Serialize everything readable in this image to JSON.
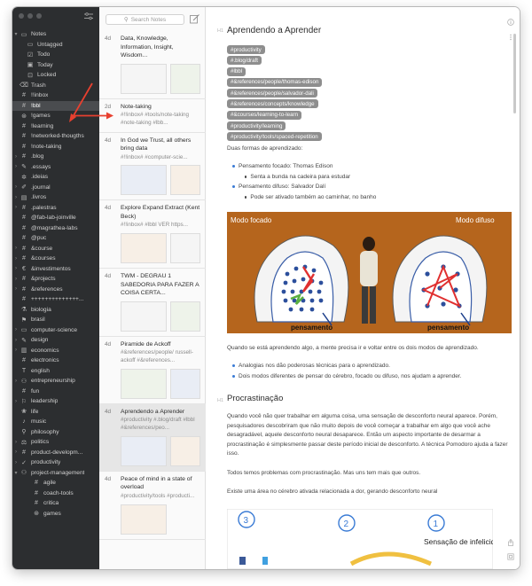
{
  "sidebar": {
    "items": [
      {
        "label": "Notes",
        "icon": "notes-icon",
        "glyph": "▭",
        "chev": "▾",
        "level": 0
      },
      {
        "label": "Untagged",
        "icon": "untagged-icon",
        "glyph": "▭",
        "chev": "",
        "level": 1
      },
      {
        "label": "Todo",
        "icon": "todo-icon",
        "glyph": "☑",
        "chev": "",
        "level": 1
      },
      {
        "label": "Today",
        "icon": "today-icon",
        "glyph": "▣",
        "chev": "",
        "level": 1
      },
      {
        "label": "Locked",
        "icon": "lock-icon",
        "glyph": "⊡",
        "chev": "",
        "level": 1
      },
      {
        "label": "Trash",
        "icon": "trash-icon",
        "glyph": "⌫",
        "chev": "",
        "level": 0
      },
      {
        "label": "!!inbox",
        "icon": "tag-icon",
        "glyph": "#",
        "chev": "",
        "level": 0
      },
      {
        "label": "!bbl",
        "icon": "tag-icon",
        "glyph": "#",
        "chev": "",
        "level": 0,
        "selected": true
      },
      {
        "label": "!games",
        "icon": "gamepad-icon",
        "glyph": "⊛",
        "chev": "",
        "level": 0
      },
      {
        "label": "!learning",
        "icon": "tag-icon",
        "glyph": "#",
        "chev": "",
        "level": 0
      },
      {
        "label": "!networked-thougths",
        "icon": "tag-icon",
        "glyph": "#",
        "chev": "",
        "level": 0
      },
      {
        "label": "!note-taking",
        "icon": "tag-icon",
        "glyph": "#",
        "chev": "",
        "level": 0
      },
      {
        "label": ".blog",
        "icon": "tag-icon",
        "glyph": "#",
        "chev": "›",
        "level": 0
      },
      {
        "label": ".essays",
        "icon": "essay-icon",
        "glyph": "✎",
        "chev": "›",
        "level": 0
      },
      {
        "label": ".ideias",
        "icon": "lightbulb-icon",
        "glyph": "✲",
        "chev": "",
        "level": 0
      },
      {
        "label": ".journal",
        "icon": "journal-icon",
        "glyph": "✐",
        "chev": "›",
        "level": 0
      },
      {
        "label": ".livros",
        "icon": "book-icon",
        "glyph": "▤",
        "chev": "›",
        "level": 0
      },
      {
        "label": ".palestras",
        "icon": "tag-icon",
        "glyph": "#",
        "chev": "›",
        "level": 0
      },
      {
        "label": "@fab-lab-joinville",
        "icon": "tag-icon",
        "glyph": "#",
        "chev": "",
        "level": 0
      },
      {
        "label": "@magrathea-labs",
        "icon": "tag-icon",
        "glyph": "#",
        "chev": "",
        "level": 0
      },
      {
        "label": "@puc",
        "icon": "tag-icon",
        "glyph": "#",
        "chev": "",
        "level": 0
      },
      {
        "label": "&course",
        "icon": "tag-icon",
        "glyph": "#",
        "chev": "›",
        "level": 0
      },
      {
        "label": "&courses",
        "icon": "tag-icon",
        "glyph": "#",
        "chev": "›",
        "level": 0
      },
      {
        "label": "&investimentos",
        "icon": "euro-icon",
        "glyph": "€",
        "chev": "›",
        "level": 0
      },
      {
        "label": "&projects",
        "icon": "tag-icon",
        "glyph": "#",
        "chev": "›",
        "level": 0
      },
      {
        "label": "&references",
        "icon": "tag-icon",
        "glyph": "#",
        "chev": "›",
        "level": 0
      },
      {
        "label": "++++++++++++++...",
        "icon": "tag-icon",
        "glyph": "#",
        "chev": "",
        "level": 0
      },
      {
        "label": "biologia",
        "icon": "flask-icon",
        "glyph": "⚗",
        "chev": "",
        "level": 0
      },
      {
        "label": "brasil",
        "icon": "flag-icon",
        "glyph": "⚑",
        "chev": "",
        "level": 0
      },
      {
        "label": "computer-science",
        "icon": "computer-icon",
        "glyph": "▭",
        "chev": "›",
        "level": 0
      },
      {
        "label": "design",
        "icon": "design-icon",
        "glyph": "✎",
        "chev": "›",
        "level": 0
      },
      {
        "label": "economics",
        "icon": "chart-icon",
        "glyph": "▥",
        "chev": "›",
        "level": 0
      },
      {
        "label": "electronics",
        "icon": "tag-icon",
        "glyph": "#",
        "chev": "",
        "level": 0
      },
      {
        "label": "english",
        "icon": "text-icon",
        "glyph": "T",
        "chev": "",
        "level": 0
      },
      {
        "label": "entrepreneurship",
        "icon": "people-icon",
        "glyph": "⚇",
        "chev": "›",
        "level": 0
      },
      {
        "label": "fun",
        "icon": "tag-icon",
        "glyph": "#",
        "chev": "",
        "level": 0
      },
      {
        "label": "leadership",
        "icon": "leadership-icon",
        "glyph": "⚐",
        "chev": "›",
        "level": 0
      },
      {
        "label": "life",
        "icon": "life-icon",
        "glyph": "❀",
        "chev": "",
        "level": 0
      },
      {
        "label": "music",
        "icon": "music-icon",
        "glyph": "♪",
        "chev": "",
        "level": 0
      },
      {
        "label": "philosophy",
        "icon": "philosophy-icon",
        "glyph": "⚲",
        "chev": "",
        "level": 0
      },
      {
        "label": "politics",
        "icon": "politics-icon",
        "glyph": "⚖",
        "chev": "›",
        "level": 0
      },
      {
        "label": "product-developm...",
        "icon": "tag-icon",
        "glyph": "#",
        "chev": "›",
        "level": 0
      },
      {
        "label": "productivity",
        "icon": "productivity-icon",
        "glyph": "✓",
        "chev": "›",
        "level": 0
      },
      {
        "label": "project-management",
        "icon": "people-icon",
        "glyph": "⚇",
        "chev": "▾",
        "level": 0
      },
      {
        "label": "agile",
        "icon": "tag-icon",
        "glyph": "#",
        "chev": "",
        "level": 2
      },
      {
        "label": "coach-tools",
        "icon": "tag-icon",
        "glyph": "#",
        "chev": "",
        "level": 2
      },
      {
        "label": "critica",
        "icon": "tag-icon",
        "glyph": "#",
        "chev": "",
        "level": 2
      },
      {
        "label": "games",
        "icon": "gamepad-icon",
        "glyph": "⊛",
        "chev": "",
        "level": 2
      }
    ]
  },
  "list": {
    "search_placeholder": "Search Notes",
    "notes": [
      {
        "age": "4d",
        "title": "Data, Knowledge, Information, Insight, Wisdom...",
        "snip": "",
        "thumbs": 2,
        "selected": false
      },
      {
        "age": "2d",
        "title": "Note-taking",
        "snip": "#!!inbox# #tools/note-taking #note-taking #lbb...",
        "thumbs": 0,
        "selected": false
      },
      {
        "age": "4d",
        "title": "In God we Trust, all others bring data",
        "snip": "#!!inbox# #computer-scie...",
        "thumbs": 2,
        "selected": false
      },
      {
        "age": "4d",
        "title": "Explore Expand Extract (Kent Beck)",
        "snip": "#!!inbox# #lbbl VER https...",
        "thumbs": 2,
        "selected": false
      },
      {
        "age": "4d",
        "title": "TWM - DEGRAU 1 SABEDORIA PARA FAZER A COISA CERTA...",
        "snip": "",
        "thumbs": 2,
        "selected": false
      },
      {
        "age": "4d",
        "title": "Piramide de Ackoff",
        "snip": "#&references/people/ russell-ackoff #&references...",
        "thumbs": 2,
        "selected": false
      },
      {
        "age": "4d",
        "title": "Aprendendo a Aprender",
        "snip": "#productivity #.blog/draft #lbbl #&references/peo...",
        "thumbs": 2,
        "selected": true
      },
      {
        "age": "4d",
        "title": "Peace of mind in a state of overload",
        "snip": "#productivity/tools #producti...",
        "thumbs": 1,
        "selected": false
      }
    ]
  },
  "editor": {
    "h1_mark": "H1",
    "h2_mark": "H1",
    "title": "Aprendendo a Aprender",
    "tags": [
      "#productivity",
      "#.blog/draft",
      "#lbbl",
      "#&references/people/thomas-edison",
      "#&references/people/salvador-dali",
      "#&references/concepts/knowledge",
      "#&courses/learning-to-learn",
      "#productivity/learning",
      "#productivity/tools/spaced-repetition"
    ],
    "intro": "Duas formas de aprendizado:",
    "bullets": [
      {
        "text": "Pensamento focado: Thomas Edison",
        "sub": "Senta a bunda na cadeira para estudar"
      },
      {
        "text": "Pensamento difuso: Salvador Dalí",
        "sub": "Pode ser ativado também ao caminhar, no banho"
      }
    ],
    "image1": {
      "left_label": "Modo focado",
      "right_label": "Modo difuso",
      "caption_left": "pensamento",
      "caption_right": "pensamento"
    },
    "para1": "Quando se está aprendendo algo, a mente precisa ir e voltar entre os dois modos de aprendizado.",
    "bullets2": [
      "Analogias nos dão poderosas técnicas para o aprendizado.",
      "Dois modos diferentes de pensar do cérebro, focado ou difuso, nos ajudam a aprender."
    ],
    "h2": "Procrastinação",
    "para2": "Quando você não quer trabalhar em alguma coisa, uma sensação de desconforto neural aparece. Porém, pesquisadores descobriram que não muito depois de você começar a trabalhar em algo que você ache desagradável, aquele desconforto neural desaparece. Então um aspecto importante de desarmar a procrastinação é simplesmente passar deste período inicial de desconforto. A técnica Pomodoro ajuda a fazer isso.",
    "para3": "Todos temos problemas com procrastinação. Mas uns tem mais que outros.",
    "para4": "Existe uma área no cérebro ativada relacionada a dor, gerando desconforto neural",
    "image2": {
      "n3": "3",
      "n2": "2",
      "n1": "1",
      "label": "Sensação de infelicidade"
    }
  },
  "colors": {
    "sidebar": "#2c2e30",
    "accent_red": "#e8402f",
    "tag_bg": "#8e8e8e",
    "link_blue": "#3a7bd5",
    "image_bg": "#b5651d"
  }
}
